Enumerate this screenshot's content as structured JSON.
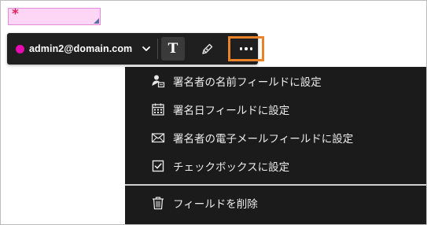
{
  "signature_field": {
    "required_marker": "*"
  },
  "toolbar": {
    "signer_email": "admin2@domain.com",
    "signer_color": "#e60bb3",
    "signer_dropdown_icon": "chevron-down-icon",
    "text_tool_glyph": "T",
    "text_tool_icon": "text-icon",
    "pen_tool_icon": "pen-icon",
    "more_options_icon": "more-horizontal-icon",
    "highlight_color": "#e8832a"
  },
  "menu": {
    "items": [
      {
        "label": "署名者の名前フィールドに設定",
        "icon": "person-name-icon"
      },
      {
        "label": "署名日フィールドに設定",
        "icon": "calendar-icon"
      },
      {
        "label": "署名者の電子メールフィールドに設定",
        "icon": "envelope-icon"
      },
      {
        "label": "チェックボックスに設定",
        "icon": "checkbox-icon"
      }
    ],
    "delete_item": {
      "label": "フィールドを削除",
      "icon": "trash-icon"
    }
  }
}
